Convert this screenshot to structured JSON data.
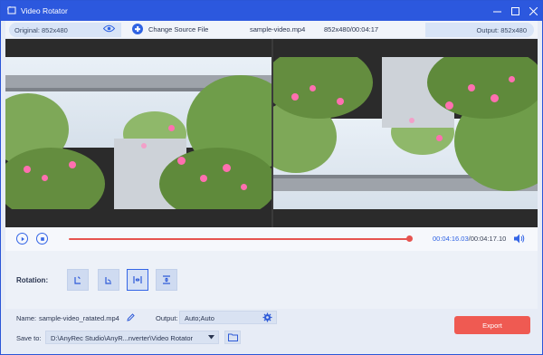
{
  "window": {
    "title": "Video Rotator",
    "accent": "#2c58de"
  },
  "infobar": {
    "original_label": "Original: 852x480",
    "change_source_label": "Change Source File",
    "file_name": "sample-video.mp4",
    "file_meta": "852x480/00:04:17",
    "output_label": "Output: 852x480"
  },
  "playback": {
    "current_time": "00:04:16.03",
    "total_time": "/00:04:17.10",
    "progress": 0.996,
    "progress_color": "#e6534f"
  },
  "rotation": {
    "label": "Rotation:",
    "buttons": [
      {
        "name": "rotate-left",
        "icon": "rotate-left-icon"
      },
      {
        "name": "rotate-right",
        "icon": "rotate-right-icon"
      },
      {
        "name": "flip-horizontal",
        "icon": "flip-horizontal-icon",
        "active": true
      },
      {
        "name": "flip-vertical",
        "icon": "flip-vertical-icon"
      }
    ]
  },
  "output_settings": {
    "name_label": "Name:",
    "name_value": "sample-video_ratated.mp4",
    "output_label": "Output:",
    "output_value": "Auto;Auto",
    "save_to_label": "Save to:",
    "save_to_value": "D:\\AnyRec Studio\\AnyR...nverter\\Video Rotator",
    "export_label": "Export",
    "export_color": "#ef5a52"
  }
}
